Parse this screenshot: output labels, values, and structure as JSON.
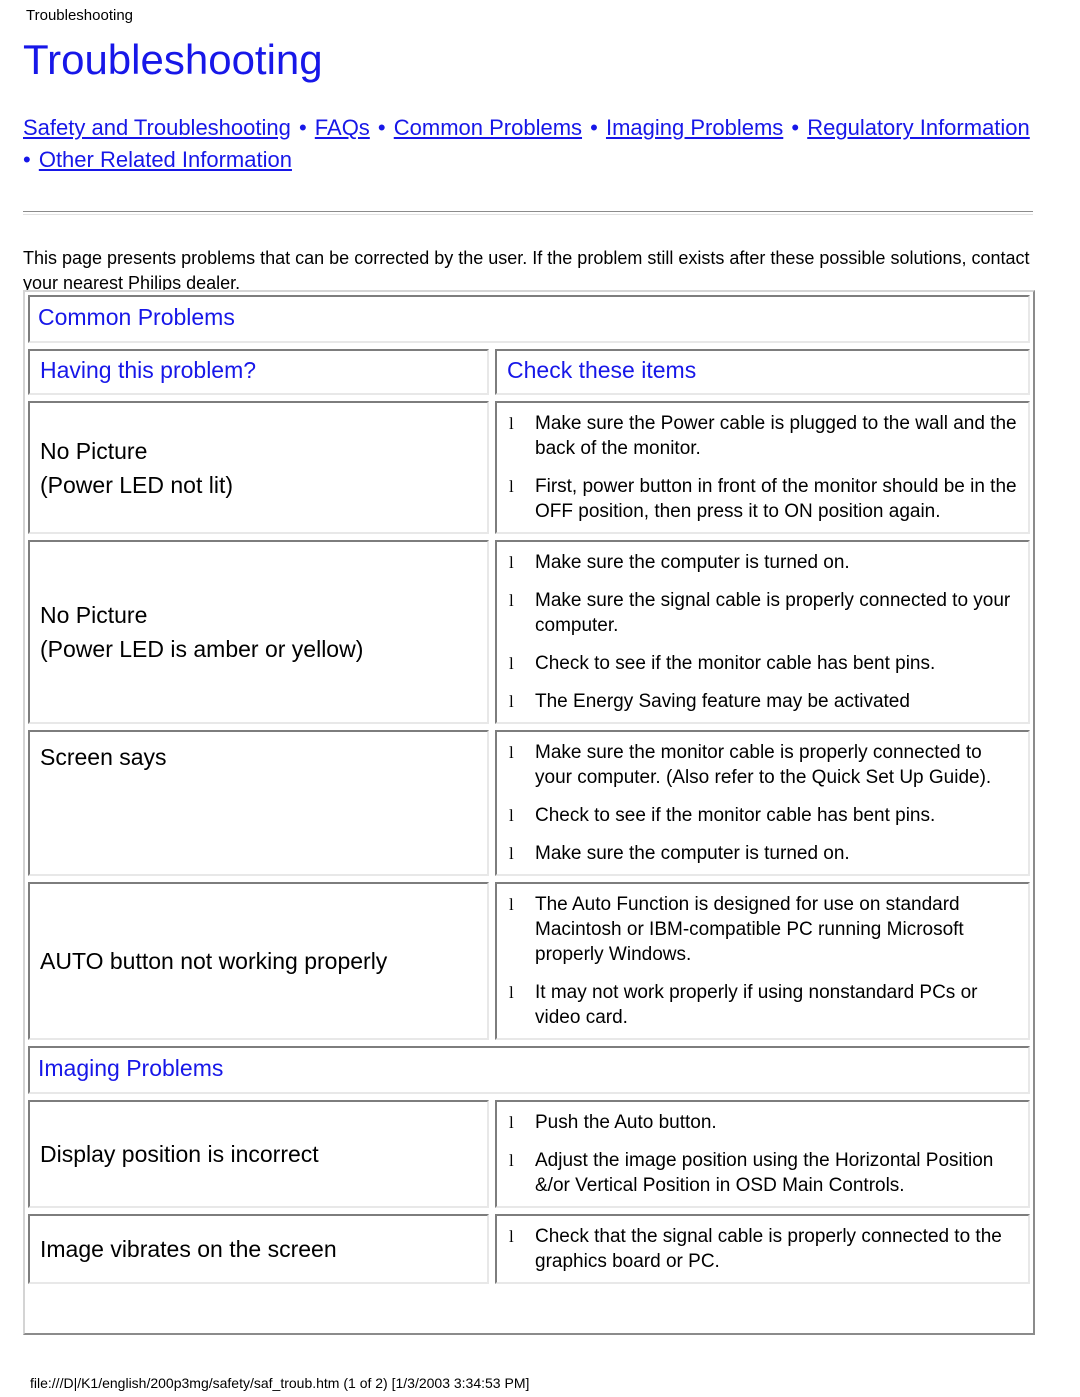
{
  "breadcrumb": "Troubleshooting",
  "page_title": "Troubleshooting",
  "colors": {
    "link_blue": "#1717e8",
    "text_black": "#000000",
    "page_background": "#ffffff"
  },
  "nav": {
    "separator": "•",
    "links": [
      "Safety and Troubleshooting",
      "FAQs",
      "Common Problems",
      "Imaging Problems",
      "Regulatory Information",
      "Other Related Information"
    ]
  },
  "intro": "This page presents problems that can be corrected by the user. If the problem still exists after these possible solutions, contact your nearest Philips dealer.",
  "table": {
    "sections": [
      {
        "title": "Common Problems",
        "column_headers": {
          "left": "Having this problem?",
          "right": "Check these items"
        },
        "rows": [
          {
            "problem_lines": [
              "No Picture",
              "(Power LED not lit)"
            ],
            "align": "center",
            "checks": [
              "Make sure the Power cable is plugged to the wall and the back of the monitor.",
              "First, power button in front of the monitor should be in the OFF position, then press it to ON position again."
            ]
          },
          {
            "problem_lines": [
              "No Picture",
              "(Power LED is amber or yellow)"
            ],
            "align": "center",
            "checks": [
              "Make sure the computer is turned on.",
              "Make sure the signal cable is properly connected to your computer.",
              "Check to see if the monitor cable has bent pins.",
              "The Energy Saving feature may be activated"
            ]
          },
          {
            "problem_lines": [
              "Screen says"
            ],
            "align": "top",
            "checks": [
              "Make sure the monitor cable is properly connected to your computer. (Also refer to the Quick Set Up Guide).",
              "Check to see if the monitor cable has bent pins.",
              "Make sure the computer is turned on."
            ]
          },
          {
            "problem_lines": [
              "AUTO button not working properly"
            ],
            "align": "center",
            "checks": [
              "The Auto Function is designed for use on standard Macintosh or IBM-compatible PC running Microsoft properly Windows.",
              "It may not work properly if using nonstandard PCs or video card."
            ]
          }
        ]
      },
      {
        "title": "Imaging Problems",
        "column_headers": null,
        "rows": [
          {
            "problem_lines": [
              "Display position is incorrect"
            ],
            "align": "center",
            "checks": [
              "Push the Auto button.",
              "Adjust the image position using the Horizontal Position &/or Vertical Position in OSD Main Controls."
            ]
          },
          {
            "problem_lines": [
              "Image vibrates on the screen"
            ],
            "align": "center",
            "checks": [
              "Check that the signal cable is properly connected to the graphics board or PC."
            ]
          }
        ]
      }
    ],
    "bullet_glyph": "l"
  },
  "footer": "file:///D|/K1/english/200p3mg/safety/saf_troub.htm (1 of 2) [1/3/2003 3:34:53 PM]"
}
